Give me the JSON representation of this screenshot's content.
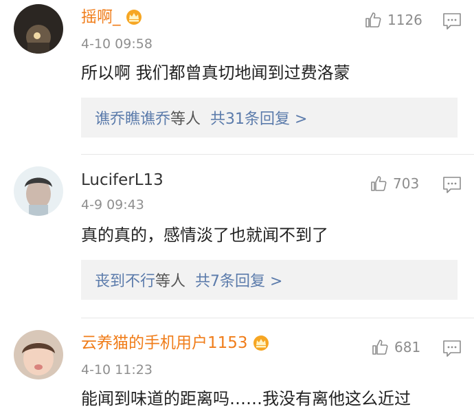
{
  "comments": [
    {
      "username": "摇啊_",
      "vip": true,
      "time": "4-10 09:58",
      "likes": "1126",
      "text": "所以啊 我们都曾真切地闻到过费洛蒙",
      "replies": {
        "who": "谯乔瞧谯乔",
        "suffix": "等人",
        "count": "共31条回复 >"
      }
    },
    {
      "username": "LuciferL13",
      "vip": false,
      "time": "4-9 09:43",
      "likes": "703",
      "text": "真的真的，感情淡了也就闻不到了",
      "replies": {
        "who": "丧到不行",
        "suffix": "等人",
        "count": "共7条回复 >"
      }
    },
    {
      "username": "云养猫的手机用户1153",
      "vip": true,
      "time": "4-10 11:23",
      "likes": "681",
      "text": "能闻到味道的距离吗……我没有离他这么近过"
    }
  ],
  "colors": {
    "vip_name": "#f07d1a",
    "reply_link": "#5b7bab",
    "reply_bg": "#f2f2f2",
    "meta": "#8f8f8f"
  },
  "icons": {
    "like": "thumbs-up-icon",
    "reply": "comment-bubble-icon",
    "vip": "crown-badge-icon"
  }
}
